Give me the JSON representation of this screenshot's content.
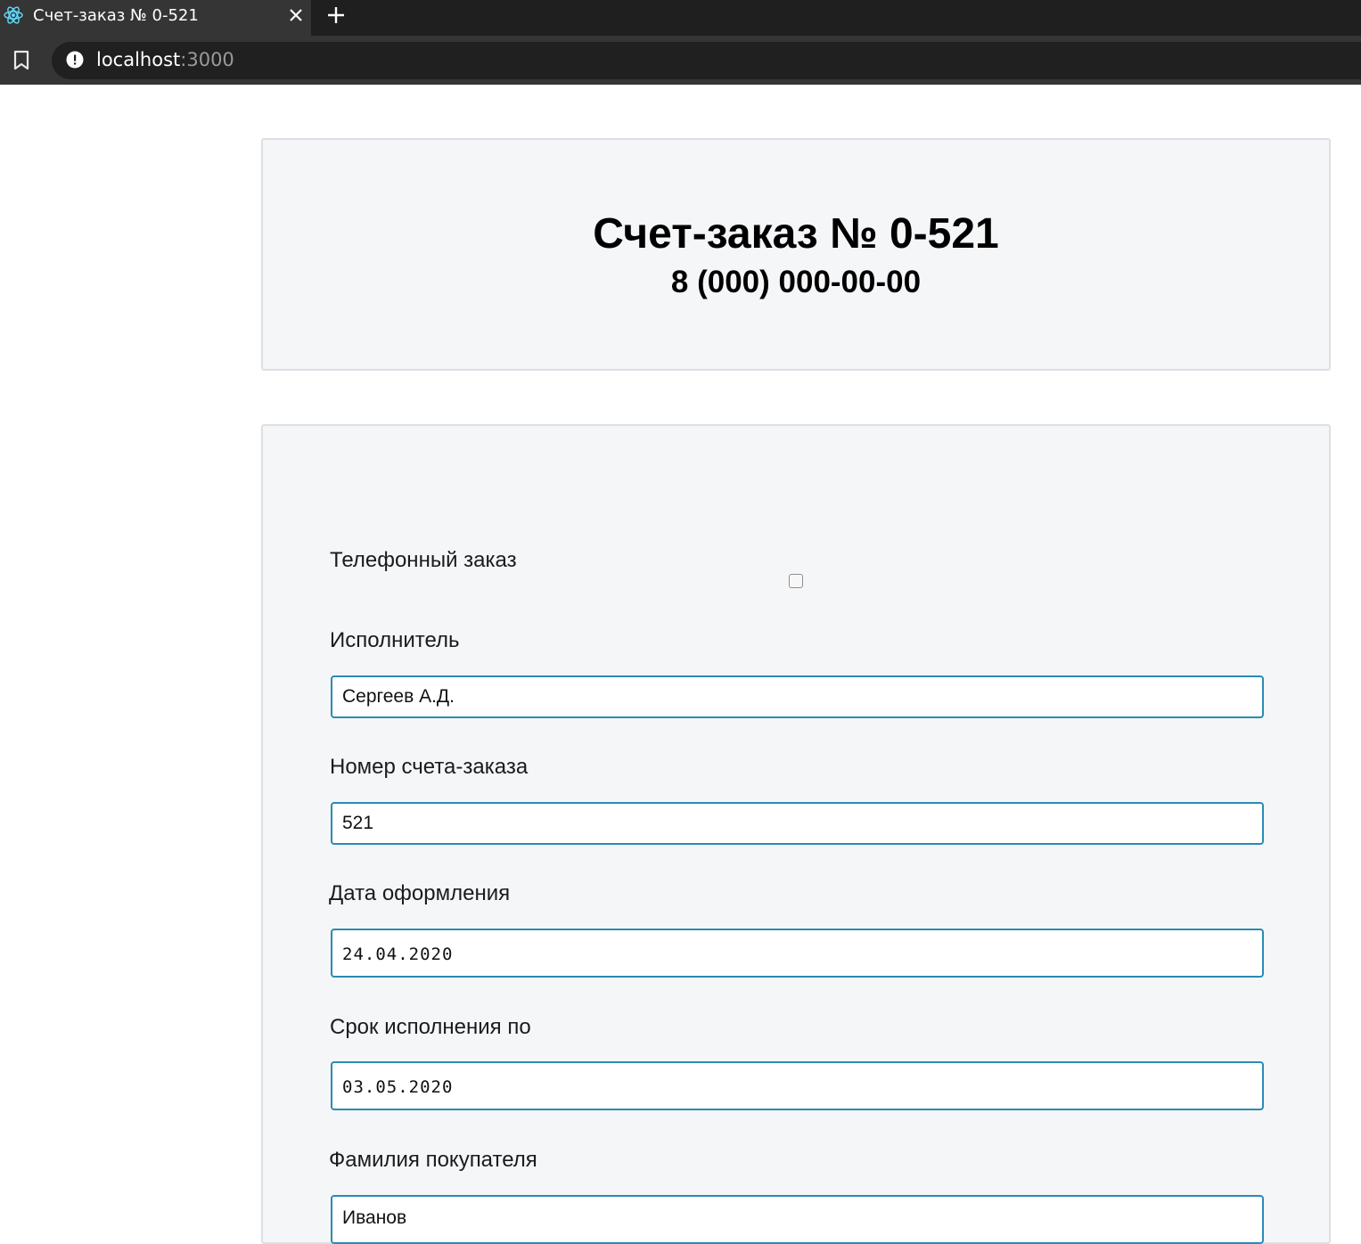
{
  "browser": {
    "tab_title": "Счет-заказ № 0-521",
    "url_host": "localhost",
    "url_port": ":3000",
    "icons": [
      "react-icon",
      "close-icon",
      "plus-icon",
      "bookmark-icon",
      "info-icon"
    ]
  },
  "header": {
    "title": "Счет-заказ № 0-521",
    "phone": "8 (000) 000-00-00"
  },
  "form": {
    "phone_order_label": "Телефонный заказ",
    "phone_order_checked": false,
    "executor_label": "Исполнитель",
    "executor_value": "Сергеев А.Д.",
    "order_number_label": "Номер счета-заказа",
    "order_number_value": "521",
    "issue_date_label": "Дата оформления",
    "issue_date_value": "24.04.2020",
    "due_date_label": "Срок исполнения по",
    "due_date_value": "03.05.2020",
    "buyer_surname_label": "Фамилия покупателя",
    "buyer_surname_value": "Иванов"
  },
  "colors": {
    "input_border": "#2a8bb5",
    "panel_bg": "#f4f6f8"
  }
}
